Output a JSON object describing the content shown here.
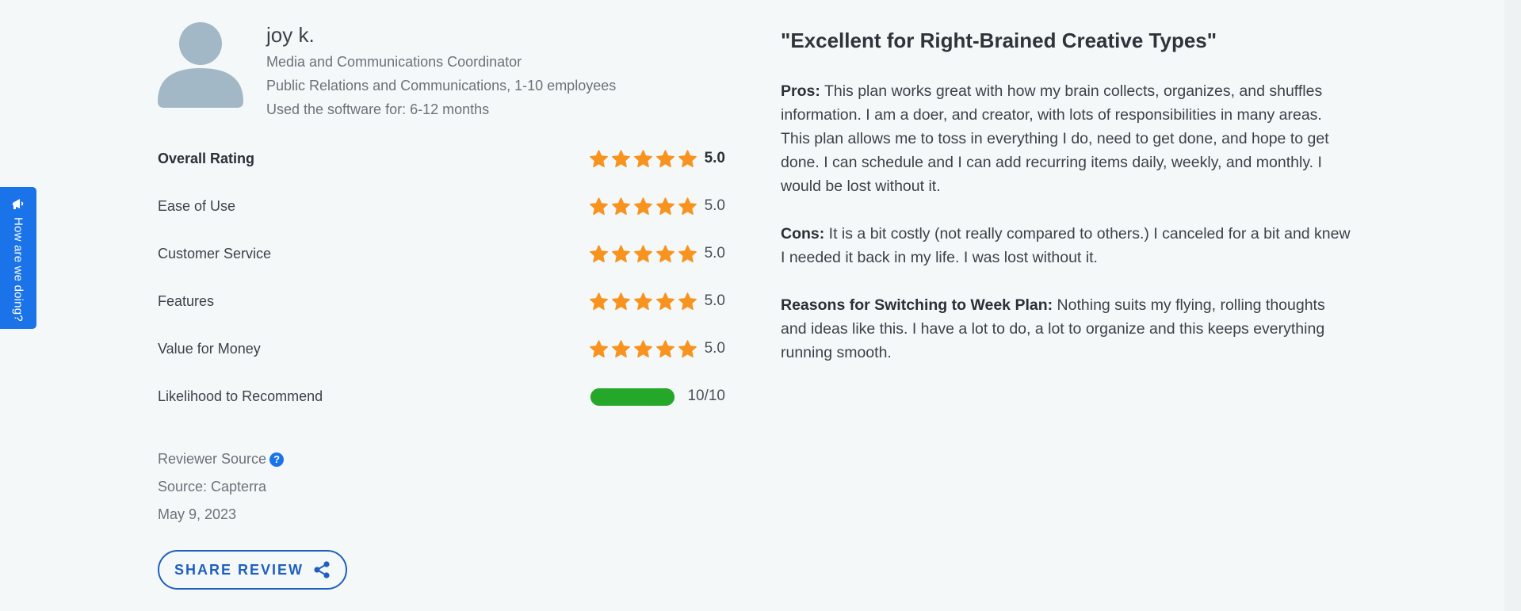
{
  "feedback_tab": {
    "label": "How are we doing?"
  },
  "reviewer": {
    "name": "joy k.",
    "title": "Media and Communications Coordinator",
    "industry": "Public Relations and Communications, 1-10 employees",
    "usage": "Used the software for: 6-12 months"
  },
  "ratings": [
    {
      "label": "Overall Rating",
      "value": "5.0",
      "stars": 5
    },
    {
      "label": "Ease of Use",
      "value": "5.0",
      "stars": 5
    },
    {
      "label": "Customer Service",
      "value": "5.0",
      "stars": 5
    },
    {
      "label": "Features",
      "value": "5.0",
      "stars": 5
    },
    {
      "label": "Value for Money",
      "value": "5.0",
      "stars": 5
    }
  ],
  "recommend": {
    "label": "Likelihood to Recommend",
    "value": "10/10",
    "fraction": 1.0
  },
  "source": {
    "reviewer_source_label": "Reviewer Source",
    "help_glyph": "?",
    "source": "Source: Capterra",
    "date": "May 9, 2023"
  },
  "share_button": {
    "label": "SHARE REVIEW"
  },
  "review": {
    "title": "\"Excellent for Right-Brained Creative Types\"",
    "pros_label": "Pros:",
    "pros_text": "This plan works great with how my brain collects, organizes, and shuffles information. I am a doer, and creator, with lots of responsibilities in many areas. This plan allows me to toss in everything I do, need to get done, and hope to get done. I can schedule and I can add recurring items daily, weekly, and monthly. I would be lost without it.",
    "cons_label": "Cons:",
    "cons_text": "It is a bit costly (not really compared to others.) I canceled for a bit and knew I needed it back in my life. I was lost without it.",
    "switch_label": "Reasons for Switching to Week Plan:",
    "switch_text": "Nothing suits my flying, rolling thoughts and ideas like this. I have a lot to do, a lot to organize and this keeps everything running smooth."
  },
  "colors": {
    "star": "#f7931e",
    "accent": "#1a73e8",
    "recommend_bar": "#25a829",
    "avatar": "#a3b8c6"
  }
}
